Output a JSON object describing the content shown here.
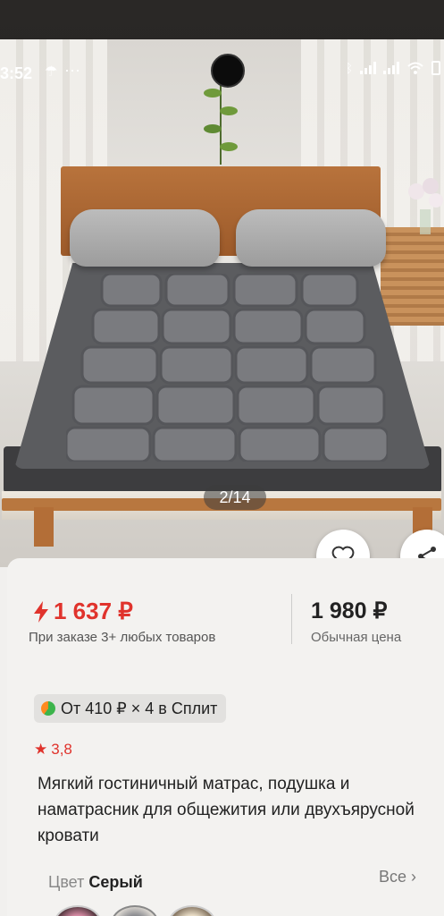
{
  "status_bar": {
    "time": "3:52",
    "icons": [
      "umbrella-icon",
      "more-dots-icon",
      "bluetooth-icon",
      "signal-icon",
      "signal-icon",
      "wifi-icon",
      "battery-icon"
    ]
  },
  "gallery": {
    "page_indicator": "2/14"
  },
  "product": {
    "sale_price": "1 637 ₽",
    "sale_price_note": "При заказе 3+ любых товаров",
    "regular_price": "1 980 ₽",
    "regular_price_note": "Обычная цена",
    "split_offer": "От 410 ₽ × 4 в Сплит",
    "rating": "3,8",
    "title": "Мягкий гостиничный матрас, подушка и наматрасник для общежития или двухъярусной кровати",
    "color_label": "Цвет",
    "color_value": "Серый",
    "all_variants_label": "Все",
    "swatches": [
      "pink",
      "gray",
      "beige"
    ]
  },
  "colors": {
    "sale_red": "#e0332c",
    "text_dark": "#222222"
  }
}
